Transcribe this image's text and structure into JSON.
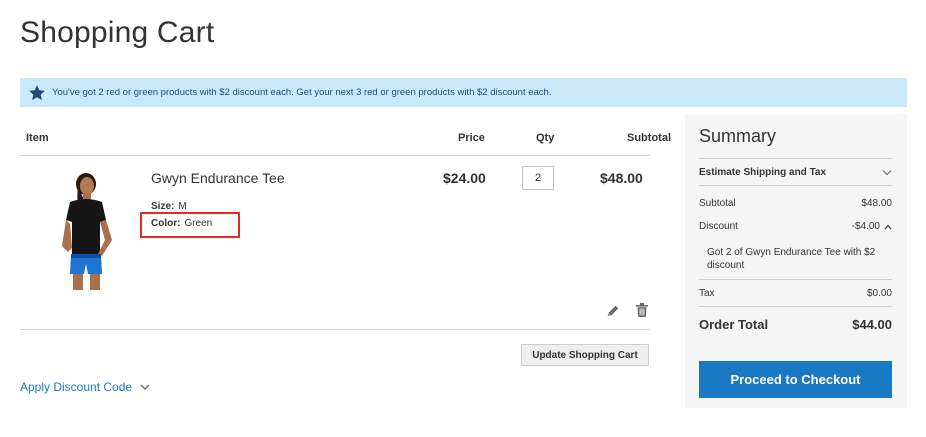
{
  "page": {
    "title": "Shopping Cart"
  },
  "notice": {
    "text": "You've got 2 red or green products with $2 discount each. Get your next 3 red or green products with $2 discount each.",
    "icon": "star-icon",
    "background": "#c9e9fb"
  },
  "cart": {
    "headers": {
      "item": "Item",
      "price": "Price",
      "qty": "Qty",
      "subtotal": "Subtotal"
    },
    "items": [
      {
        "name": "Gwyn Endurance Tee",
        "options": [
          {
            "label": "Size:",
            "value": "M"
          },
          {
            "label": "Color:",
            "value": "Green"
          }
        ],
        "price": "$24.00",
        "qty": "2",
        "subtotal": "$48.00"
      }
    ],
    "update_label": "Update Shopping Cart",
    "discount_link": "Apply Discount Code"
  },
  "summary": {
    "title": "Summary",
    "shipping_label": "Estimate Shipping and Tax",
    "subtotal_label": "Subtotal",
    "subtotal_value": "$48.00",
    "discount_label": "Discount",
    "discount_value": "-$4.00",
    "discount_detail": "Got 2 of Gwyn Endurance Tee with $2 discount",
    "tax_label": "Tax",
    "tax_value": "$0.00",
    "order_total_label": "Order Total",
    "order_total_value": "$44.00",
    "checkout_label": "Proceed to Checkout"
  },
  "colors": {
    "accent": "#1979c3",
    "highlight": "#e02b27",
    "summary_bg": "#f5f5f5"
  }
}
